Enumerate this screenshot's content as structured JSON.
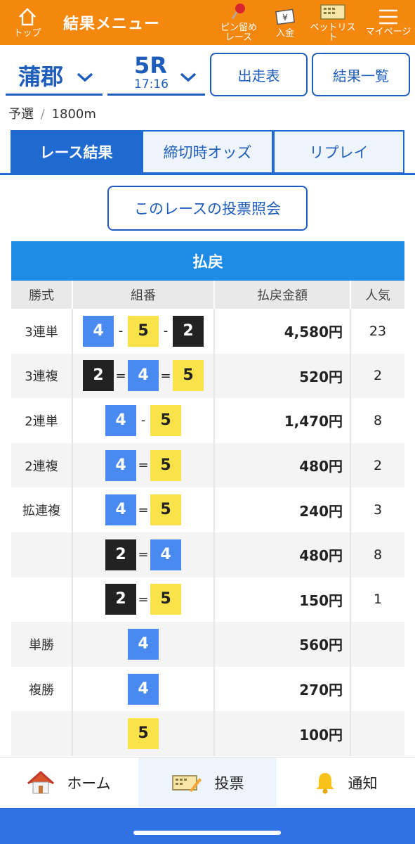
{
  "header": {
    "title": "結果メニュー",
    "top_label": "トップ",
    "pin_label": "ピン留め\nレース",
    "deposit_label": "入金",
    "betlist_label": "ベットリスト",
    "mypage_label": "マイページ",
    "bg_color": "#f4870e"
  },
  "venue": {
    "name": "蒲郡",
    "race": "5R",
    "time": "17:16"
  },
  "buttons": {
    "entry_table": "出走表",
    "result_list": "結果一覧",
    "inquiry": "このレースの投票照会"
  },
  "race_info": {
    "grade": "予選",
    "separator": "/",
    "distance": "1800m"
  },
  "tabs": [
    "レース結果",
    "締切時オッズ",
    "リプレイ"
  ],
  "payout": {
    "heading": "払戻",
    "columns": [
      "勝式",
      "組番",
      "払戻金額",
      "人気"
    ],
    "rows": [
      {
        "type": "3連単",
        "combo": [
          "4",
          "-",
          "5",
          "-",
          "2"
        ],
        "amount": "4,580円",
        "pop": "23"
      },
      {
        "type": "3連複",
        "combo": [
          "2",
          "=",
          "4",
          "=",
          "5"
        ],
        "amount": "520円",
        "pop": "2"
      },
      {
        "type": "2連単",
        "combo": [
          "4",
          "-",
          "5"
        ],
        "amount": "1,470円",
        "pop": "8"
      },
      {
        "type": "2連複",
        "combo": [
          "4",
          "=",
          "5"
        ],
        "amount": "480円",
        "pop": "2"
      },
      {
        "type": "拡連複",
        "combo": [
          "4",
          "=",
          "5"
        ],
        "amount": "240円",
        "pop": "3"
      },
      {
        "type": "",
        "combo": [
          "2",
          "=",
          "4"
        ],
        "amount": "480円",
        "pop": "8"
      },
      {
        "type": "",
        "combo": [
          "2",
          "=",
          "5"
        ],
        "amount": "150円",
        "pop": "1"
      },
      {
        "type": "単勝",
        "combo": [
          "4"
        ],
        "amount": "560円",
        "pop": ""
      },
      {
        "type": "複勝",
        "combo": [
          "4"
        ],
        "amount": "270円",
        "pop": ""
      },
      {
        "type": "",
        "combo": [
          "5"
        ],
        "amount": "100円",
        "pop": ""
      }
    ]
  },
  "footer": {
    "home": "ホーム",
    "vote": "投票",
    "notify": "通知"
  },
  "colors": {
    "accent": "#1e6ad0",
    "boat2": "#222222",
    "boat4": "#4a8af0",
    "boat5": "#fae34a"
  }
}
